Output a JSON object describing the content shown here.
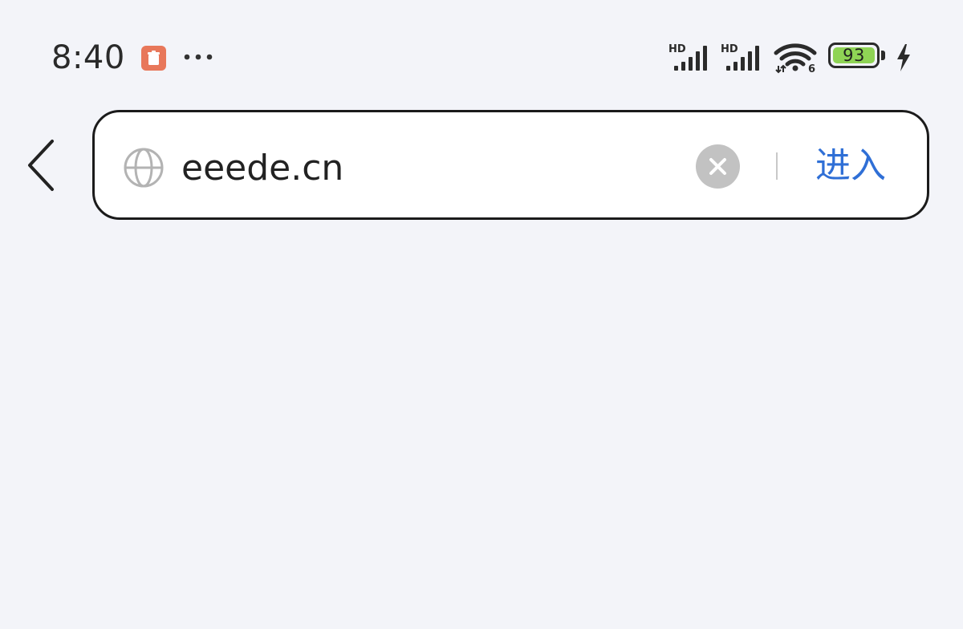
{
  "status_bar": {
    "time": "8:40",
    "notification_icon": "app-notification-icon",
    "more_indicator": "more-notifications-icon",
    "signal_1_label": "HD",
    "signal_2_label": "HD",
    "wifi_label": "6",
    "battery_level": "93",
    "charging": true
  },
  "address_bar": {
    "back_icon": "back-chevron-icon",
    "site_icon": "globe-icon",
    "url_value": "eeede.cn",
    "clear_icon": "clear-icon",
    "go_label": "进入",
    "go_color": "#2f6fd6"
  },
  "colors": {
    "page_background": "#f3f4f9",
    "notification_badge": "#e8775a",
    "battery_fill": "#8fd455"
  }
}
